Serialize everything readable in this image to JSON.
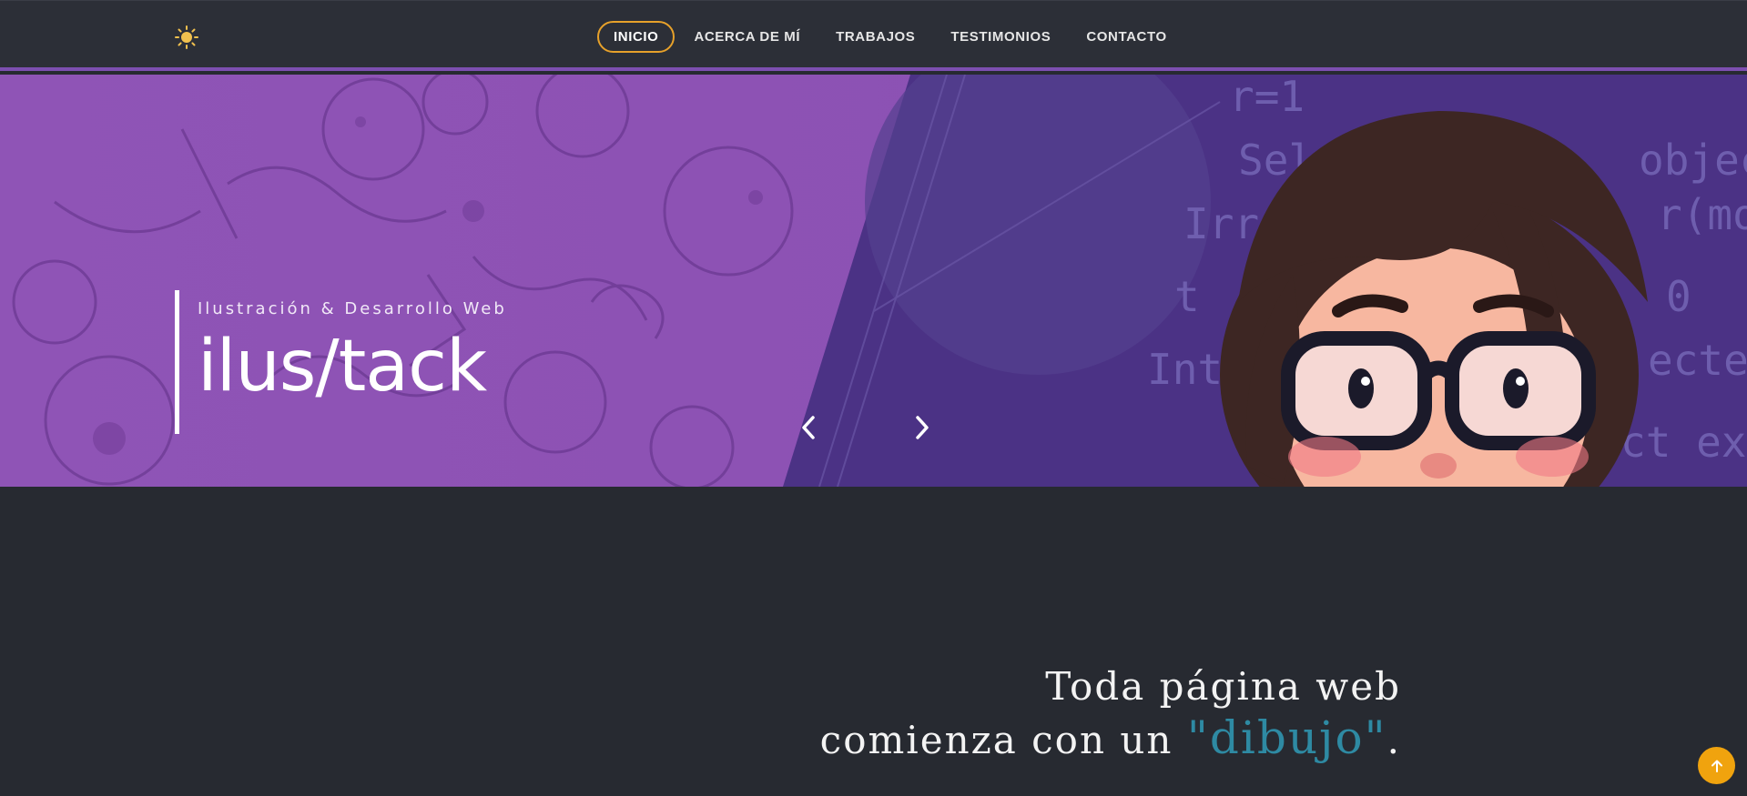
{
  "navbar": {
    "theme_icon": "sun-icon",
    "items": [
      {
        "label": "INICIO",
        "active": true
      },
      {
        "label": "ACERCA DE MÍ",
        "active": false
      },
      {
        "label": "TRABAJOS",
        "active": false
      },
      {
        "label": "TESTIMONIOS",
        "active": false
      },
      {
        "label": "CONTACTO",
        "active": false
      }
    ]
  },
  "hero": {
    "subtitle": "Ilustración & Desarrollo Web",
    "title": "ilus/tack",
    "prev_icon": "chevron-left-icon",
    "next_icon": "chevron-right-icon"
  },
  "tagline": {
    "line1": "Toda página web",
    "line2_prefix": "comienza con un ",
    "highlight": "\"dibujo\"",
    "line2_suffix": "."
  },
  "scroll_top": {
    "icon": "arrow-up-icon"
  },
  "colors": {
    "background": "#272a31",
    "navbar": "#2c2f37",
    "accent_purple": "#7d4fb0",
    "active_outline": "#e7a12a",
    "highlight_teal": "#2e8aa3",
    "scroll_button": "#f0a30e"
  }
}
